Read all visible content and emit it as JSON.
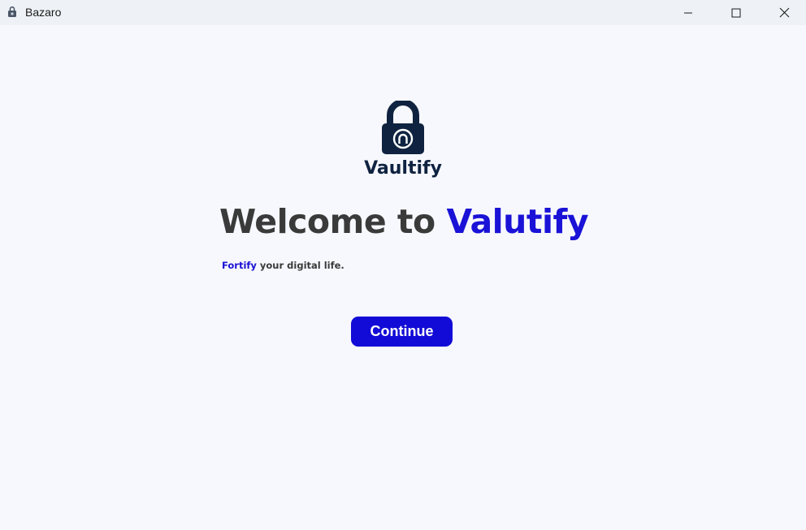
{
  "window": {
    "title": "Bazaro",
    "app_icon": "lock-icon",
    "controls": {
      "minimize_icon": "minimize-icon",
      "maximize_icon": "maximize-icon",
      "close_icon": "close-icon"
    }
  },
  "brand": {
    "logo_icon": "padlock-logo-icon",
    "name": "Vaultify",
    "logo_color": "#0f2340"
  },
  "hero": {
    "headline_prefix": "Welcome to ",
    "headline_accent": "Valutify",
    "tagline_accent": "Fortify",
    "tagline_rest": " your digital life."
  },
  "actions": {
    "continue_label": "Continue"
  },
  "colors": {
    "accent": "#1a12d6",
    "button": "#120ad6",
    "text_dark": "#3a3a3a",
    "background": "#f7f8fd",
    "titlebar": "#eef2f6"
  }
}
